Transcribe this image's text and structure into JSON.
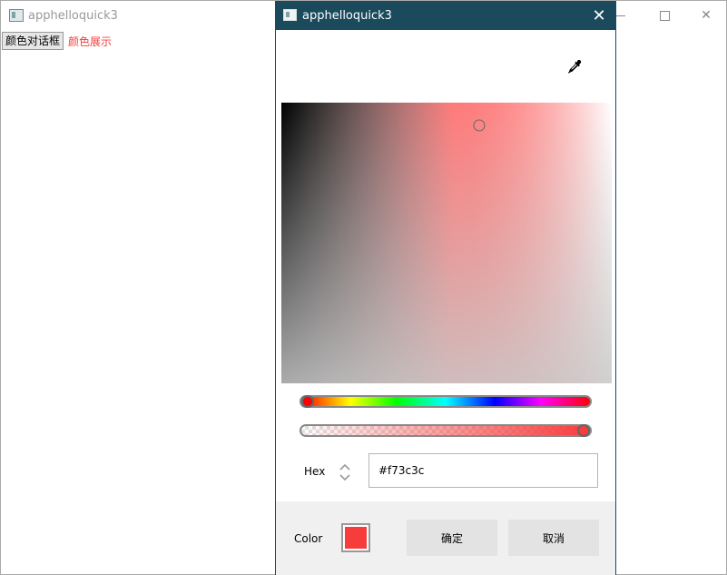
{
  "main_window": {
    "title": "apphelloquick3",
    "open_dialog_button_label": "颜色对话框",
    "color_display_label": "颜色展示",
    "color_display_color": "#f73c3c"
  },
  "dialog": {
    "title": "apphelloquick3",
    "hue_fraction": 0.0,
    "alpha_fraction": 1.0,
    "saturation_fraction": 0.6,
    "value_fraction": 0.92,
    "hex_label": "Hex",
    "hex_value": "#f73c3c",
    "color_label": "Color",
    "selected_color": "#f73c3c",
    "ok_label": "确定",
    "cancel_label": "取消",
    "titlebar_color": "#1a4a5c"
  },
  "icons": {
    "app": "window-app-icon",
    "eyedropper": "eyedropper-icon",
    "close": "close-icon",
    "spinner": "up-down-chevron-icon"
  }
}
